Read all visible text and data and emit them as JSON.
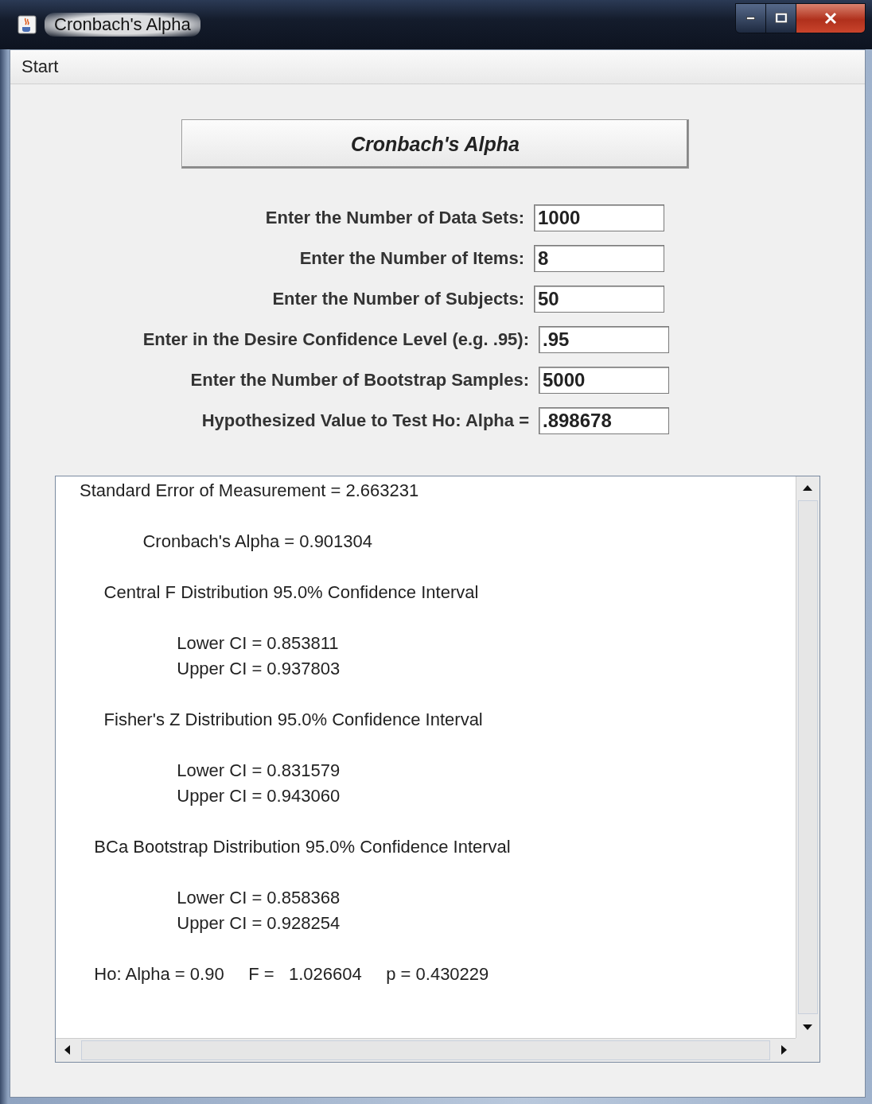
{
  "window": {
    "title": "Cronbach's Alpha"
  },
  "menu": [
    {
      "label": "Start"
    }
  ],
  "header_button": {
    "label": "Cronbach's Alpha"
  },
  "fields": [
    {
      "label": "Enter the Number of Data Sets:",
      "value": "1000"
    },
    {
      "label": "Enter the Number of Items:",
      "value": "8"
    },
    {
      "label": "Enter the Number of Subjects:",
      "value": "50"
    },
    {
      "label": "Enter in the Desire Confidence Level (e.g. .95):",
      "value": ".95"
    },
    {
      "label": "Enter the Number of Bootstrap Samples:",
      "value": "5000"
    },
    {
      "label": "Hypothesized Value to Test Ho: Alpha =",
      "value": ".898678"
    }
  ],
  "output": {
    "blocks": [
      [
        "Standard Error of Measurement = 2.663231"
      ],
      [
        "             Cronbach's Alpha = 0.901304"
      ],
      [
        "     Central F Distribution 95.0% Confidence Interval"
      ],
      [
        "                    Lower CI = 0.853811",
        "                    Upper CI = 0.937803"
      ],
      [
        "     Fisher's Z Distribution 95.0% Confidence Interval"
      ],
      [
        "                    Lower CI = 0.831579",
        "                    Upper CI = 0.943060"
      ],
      [
        "   BCa Bootstrap Distribution 95.0% Confidence Interval"
      ],
      [
        "                    Lower CI = 0.858368",
        "                    Upper CI = 0.928254"
      ],
      [
        "   Ho: Alpha = 0.90     F =   1.026604     p = 0.430229"
      ]
    ]
  }
}
